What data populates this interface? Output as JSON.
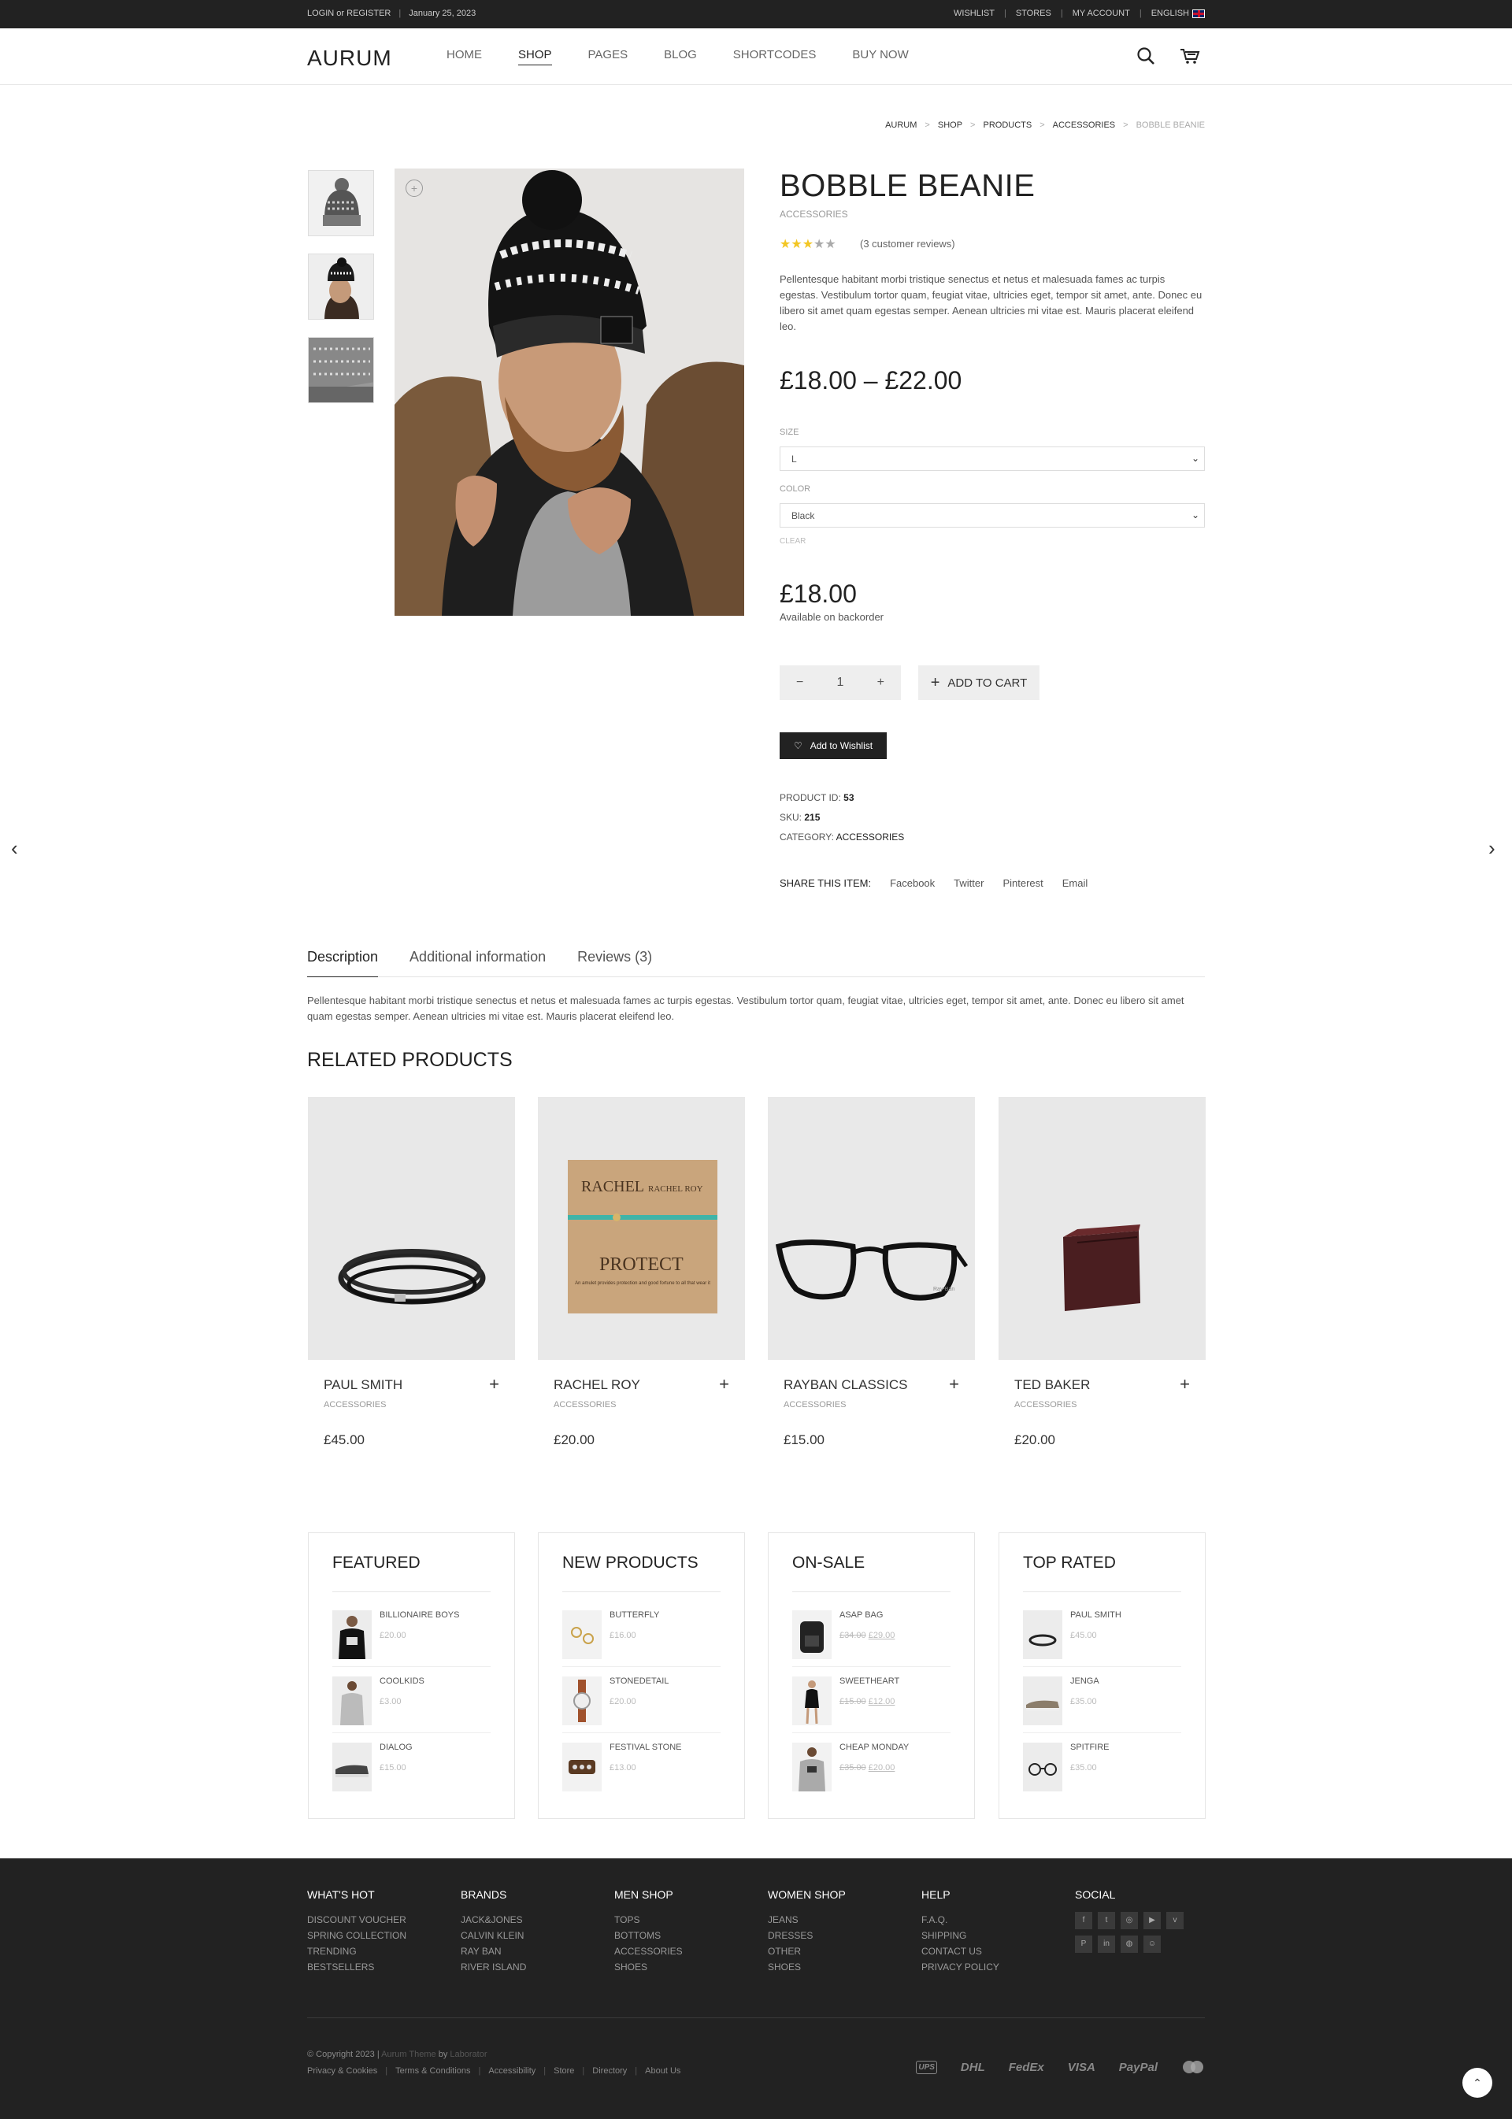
{
  "topbar": {
    "login": "LOGIN or REGISTER",
    "date": "January 25, 2023",
    "links": [
      "WISHLIST",
      "STORES",
      "MY ACCOUNT",
      "ENGLISH"
    ]
  },
  "header": {
    "logo": "AURUM",
    "nav": [
      "HOME",
      "SHOP",
      "PAGES",
      "BLOG",
      "SHORTCODES",
      "BUY NOW"
    ],
    "active": "SHOP"
  },
  "breadcrumb": [
    "AURUM",
    "SHOP",
    "PRODUCTS",
    "ACCESSORIES",
    "BOBBLE BEANIE"
  ],
  "product": {
    "title": "BOBBLE BEANIE",
    "category": "ACCESSORIES",
    "rating": 3,
    "reviews": "(3 customer reviews)",
    "description": "Pellentesque habitant morbi tristique senectus et netus et malesuada fames ac turpis egestas. Vestibulum tortor quam, feugiat vitae, ultricies eget, tempor sit amet, ante. Donec eu libero sit amet quam egestas semper. Aenean ultricies mi vitae est. Mauris placerat eleifend leo.",
    "price_range": "£18.00 – £22.00",
    "size_label": "SIZE",
    "size_value": "L",
    "color_label": "COLOR",
    "color_value": "Black",
    "clear": "CLEAR",
    "variation_price": "£18.00",
    "availability": "Available on backorder",
    "qty": "1",
    "add_to_cart": "ADD TO CART",
    "wishlist": "Add to Wishlist",
    "meta": {
      "id_label": "PRODUCT ID:",
      "id": "53",
      "sku_label": "SKU:",
      "sku": "215",
      "cat_label": "CATEGORY:",
      "cat": "ACCESSORIES"
    },
    "share": {
      "label": "SHARE THIS ITEM:",
      "links": [
        "Facebook",
        "Twitter",
        "Pinterest",
        "Email"
      ]
    }
  },
  "tabs": {
    "items": [
      "Description",
      "Additional information",
      "Reviews (3)"
    ],
    "active": "Description",
    "content": "Pellentesque habitant morbi tristique senectus et netus et malesuada fames ac turpis egestas. Vestibulum tortor quam, feugiat vitae, ultricies eget, tempor sit amet, ante. Donec eu libero sit amet quam egestas semper. Aenean ultricies mi vitae est. Mauris placerat eleifend leo."
  },
  "related": {
    "title": "RELATED PRODUCTS",
    "items": [
      {
        "name": "PAUL SMITH",
        "cat": "ACCESSORIES",
        "price": "£45.00"
      },
      {
        "name": "RACHEL ROY",
        "cat": "ACCESSORIES",
        "price": "£20.00"
      },
      {
        "name": "RAYBAN CLASSICS",
        "cat": "ACCESSORIES",
        "price": "£15.00"
      },
      {
        "name": "TED BAKER",
        "cat": "ACCESSORIES",
        "price": "£20.00"
      }
    ],
    "card_text": {
      "rachel_top": "RACHEL",
      "rachel_brand": "RACHEL ROY",
      "protect": "PROTECT",
      "protect_sub": "An amulet provides protection and good fortune to all that wear it",
      "glasses_brand": "Ray-Ban"
    }
  },
  "widgets": [
    {
      "title": "FEATURED",
      "items": [
        {
          "name": "BILLIONAIRE BOYS",
          "price": "£20.00"
        },
        {
          "name": "COOLKIDS",
          "price": "£3.00"
        },
        {
          "name": "DIALOG",
          "price": "£15.00"
        }
      ]
    },
    {
      "title": "NEW PRODUCTS",
      "items": [
        {
          "name": "BUTTERFLY",
          "price": "£16.00"
        },
        {
          "name": "STONEDETAIL",
          "price": "£20.00"
        },
        {
          "name": "FESTIVAL STONE",
          "price": "£13.00"
        }
      ]
    },
    {
      "title": "ON-SALE",
      "items": [
        {
          "name": "ASAP BAG",
          "old": "£34.00",
          "price": "£29.00"
        },
        {
          "name": "SWEETHEART",
          "old": "£15.00",
          "price": "£12.00"
        },
        {
          "name": "CHEAP MONDAY",
          "old": "£35.00",
          "price": "£20.00"
        }
      ]
    },
    {
      "title": "TOP RATED",
      "items": [
        {
          "name": "PAUL SMITH",
          "price": "£45.00"
        },
        {
          "name": "JENGA",
          "price": "£35.00"
        },
        {
          "name": "SPITFIRE",
          "price": "£35.00"
        }
      ]
    }
  ],
  "footer": {
    "cols": [
      {
        "title": "WHAT'S HOT",
        "links": [
          "DISCOUNT VOUCHER",
          "SPRING COLLECTION",
          "TRENDING",
          "BESTSELLERS"
        ]
      },
      {
        "title": "BRANDS",
        "links": [
          "JACK&JONES",
          "CALVIN KLEIN",
          "RAY BAN",
          "RIVER ISLAND"
        ]
      },
      {
        "title": "MEN SHOP",
        "links": [
          "TOPS",
          "BOTTOMS",
          "ACCESSORIES",
          "SHOES"
        ]
      },
      {
        "title": "WOMEN SHOP",
        "links": [
          "JEANS",
          "DRESSES",
          "OTHER",
          "SHOES"
        ]
      },
      {
        "title": "HELP",
        "links": [
          "F.A.Q.",
          "SHIPPING",
          "CONTACT US",
          "PRIVACY POLICY"
        ]
      }
    ],
    "social_title": "SOCIAL",
    "copyright": {
      "pre": "© Copyright 2023 |",
      "theme": "Aurum Theme",
      "by": "by",
      "author": "Laborator"
    },
    "links": [
      "Privacy & Cookies",
      "Terms & Conditions",
      "Accessibility",
      "Store",
      "Directory",
      "About Us"
    ],
    "payments": [
      "UPS",
      "DHL",
      "FedEx",
      "VISA",
      "PayPal",
      "MC"
    ]
  }
}
